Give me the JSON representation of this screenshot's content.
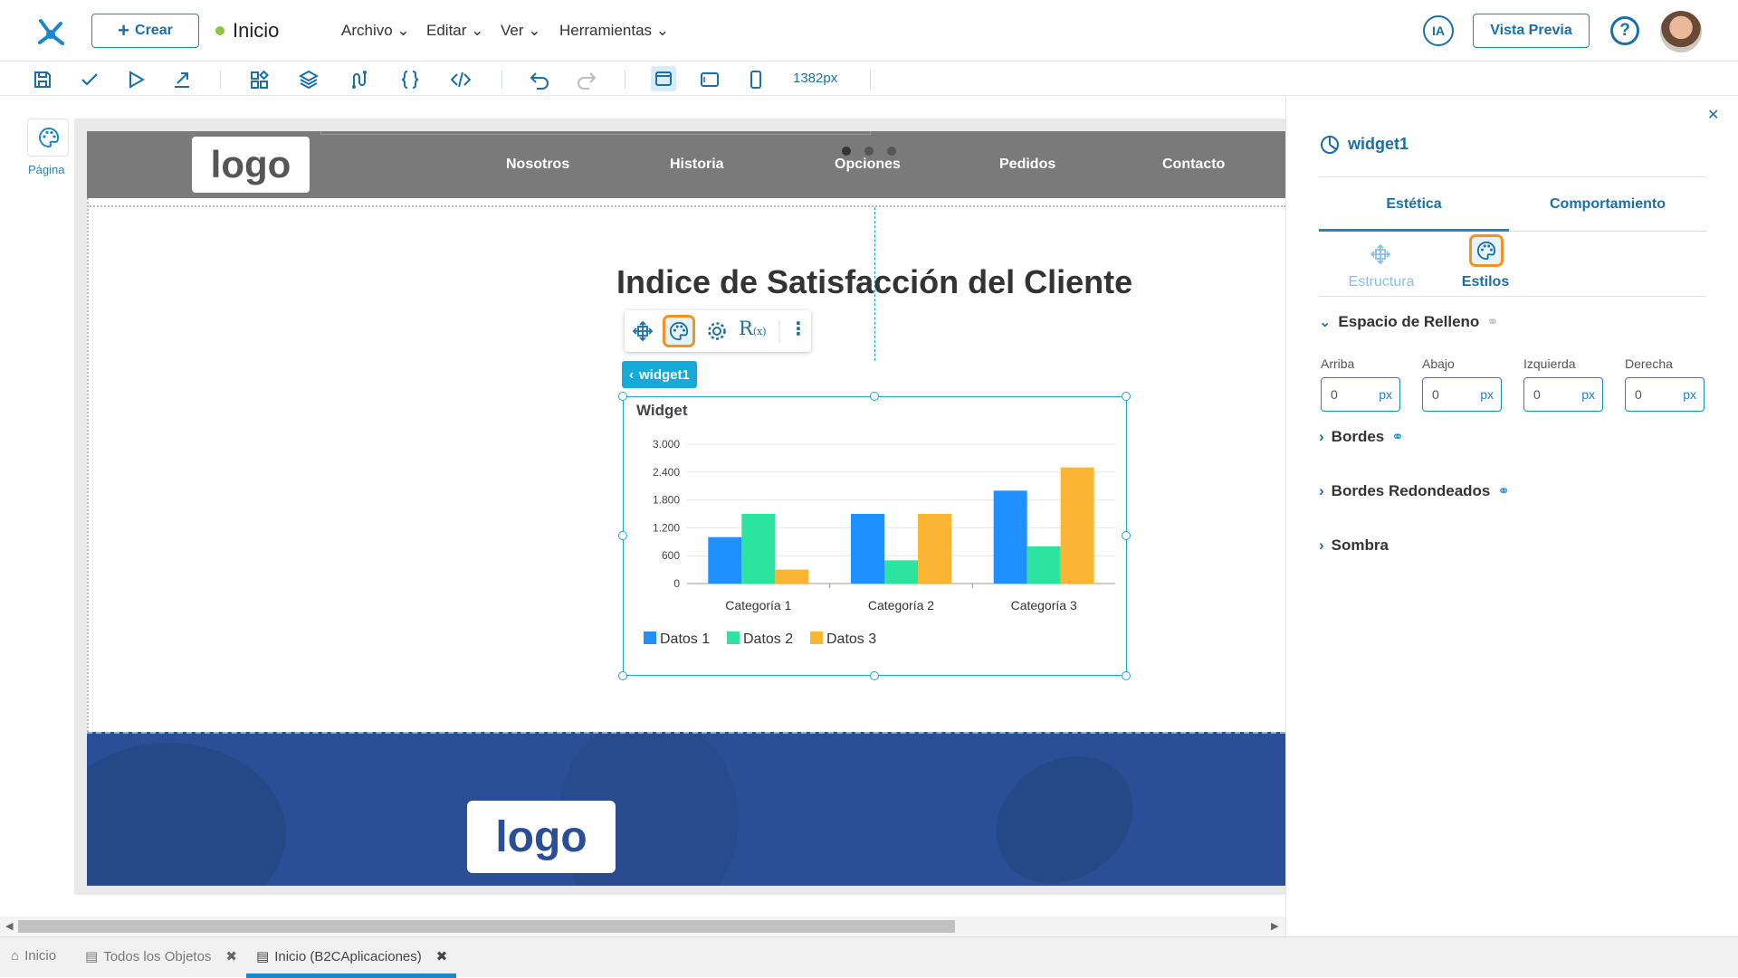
{
  "topbar": {
    "create_label": "Crear",
    "page_name": "Inicio",
    "menus": [
      "Archivo",
      "Editar",
      "Ver",
      "Herramientas"
    ],
    "ia_label": "IA",
    "preview_label": "Vista Previa",
    "help_label": "?"
  },
  "toolbar": {
    "width_readout": "1382px"
  },
  "left_rail": {
    "page_label": "Página"
  },
  "site": {
    "header_logo": "logo",
    "nav": [
      "Nosotros",
      "Historia",
      "Opciones",
      "Pedidos",
      "Contacto"
    ],
    "title": "Indice de Satisfacción del Cliente",
    "footer_logo": "logo"
  },
  "widget": {
    "tag_label": "widget1",
    "card_title": "Widget"
  },
  "chart_data": {
    "type": "bar",
    "title": "Widget",
    "categories": [
      "Categoría 1",
      "Categoría 2",
      "Categoría 3"
    ],
    "series": [
      {
        "name": "Datos 1",
        "color": "#1e90ff",
        "values": [
          1000,
          1500,
          2000
        ]
      },
      {
        "name": "Datos 2",
        "color": "#2de3a0",
        "values": [
          1500,
          500,
          800
        ]
      },
      {
        "name": "Datos 3",
        "color": "#fbb534",
        "values": [
          300,
          1500,
          2500
        ]
      }
    ],
    "yticks": [
      "3.000",
      "2.400",
      "1.800",
      "1.200",
      "600",
      "0"
    ],
    "ylim": [
      0,
      3000
    ],
    "grid": true,
    "legend": "bottom-left"
  },
  "panel": {
    "widget_name": "widget1",
    "tabs": [
      "Estética",
      "Comportamiento"
    ],
    "subtabs": [
      "Estructura",
      "Estilos"
    ],
    "padding_section": "Espacio de Relleno",
    "fields": [
      {
        "label": "Arriba",
        "value": "0",
        "unit": "px"
      },
      {
        "label": "Abajo",
        "value": "0",
        "unit": "px"
      },
      {
        "label": "Izquierda",
        "value": "0",
        "unit": "px"
      },
      {
        "label": "Derecha",
        "value": "0",
        "unit": "px"
      }
    ],
    "sections": [
      "Bordes",
      "Bordes Redondeados",
      "Sombra"
    ]
  },
  "bottom_tabs": [
    {
      "label": "Inicio"
    },
    {
      "label": "Todos los Objetos"
    },
    {
      "label": "Inicio (B2CAplicaciones)"
    }
  ],
  "colors": {
    "accent": "#1a87c9",
    "selected_outline": "#f2921f",
    "widget_tag": "#17a9d8",
    "footer_blue": "#2b4f96"
  }
}
